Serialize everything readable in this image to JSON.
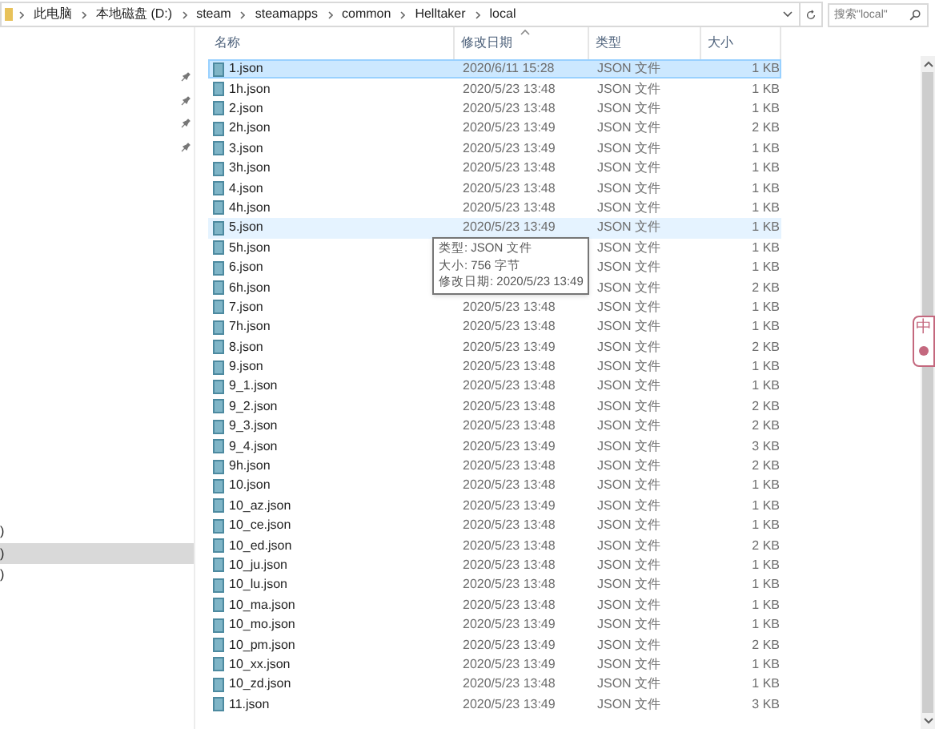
{
  "address_bar": {
    "path": [
      "此电脑",
      "本地磁盘 (D:)",
      "steam",
      "steamapps",
      "common",
      "Helltaker",
      "local"
    ]
  },
  "search": {
    "placeholder": "搜索\"local\""
  },
  "nav_pane": {
    "items": [
      {
        "label": ")",
        "selected": false
      },
      {
        "label": ")",
        "selected": true
      },
      {
        "label": ")",
        "selected": false
      }
    ]
  },
  "columns": [
    "名称",
    "修改日期",
    "类型",
    "大小"
  ],
  "rows": [
    {
      "name": "1.json",
      "modified": "2020/6/11 15:28",
      "type": "JSON 文件",
      "size": "1 KB",
      "selected": true,
      "hover": false
    },
    {
      "name": "1h.json",
      "modified": "2020/5/23 13:48",
      "type": "JSON 文件",
      "size": "1 KB",
      "selected": false,
      "hover": false
    },
    {
      "name": "2.json",
      "modified": "2020/5/23 13:48",
      "type": "JSON 文件",
      "size": "1 KB",
      "selected": false,
      "hover": false
    },
    {
      "name": "2h.json",
      "modified": "2020/5/23 13:49",
      "type": "JSON 文件",
      "size": "2 KB",
      "selected": false,
      "hover": false
    },
    {
      "name": "3.json",
      "modified": "2020/5/23 13:49",
      "type": "JSON 文件",
      "size": "1 KB",
      "selected": false,
      "hover": false
    },
    {
      "name": "3h.json",
      "modified": "2020/5/23 13:48",
      "type": "JSON 文件",
      "size": "1 KB",
      "selected": false,
      "hover": false
    },
    {
      "name": "4.json",
      "modified": "2020/5/23 13:48",
      "type": "JSON 文件",
      "size": "1 KB",
      "selected": false,
      "hover": false
    },
    {
      "name": "4h.json",
      "modified": "2020/5/23 13:48",
      "type": "JSON 文件",
      "size": "1 KB",
      "selected": false,
      "hover": false
    },
    {
      "name": "5.json",
      "modified": "2020/5/23 13:49",
      "type": "JSON 文件",
      "size": "1 KB",
      "selected": false,
      "hover": true
    },
    {
      "name": "5h.json",
      "type": "JSON 文件",
      "size": "1 KB",
      "selected": false,
      "hover": false
    },
    {
      "name": "6.json",
      "type": "JSON 文件",
      "size": "1 KB",
      "selected": false,
      "hover": false
    },
    {
      "name": "6h.json",
      "type": "JSON 文件",
      "size": "2 KB",
      "selected": false,
      "hover": false
    },
    {
      "name": "7.json",
      "modified": "2020/5/23 13:48",
      "type": "JSON 文件",
      "size": "1 KB",
      "selected": false,
      "hover": false
    },
    {
      "name": "7h.json",
      "modified": "2020/5/23 13:48",
      "type": "JSON 文件",
      "size": "1 KB",
      "selected": false,
      "hover": false
    },
    {
      "name": "8.json",
      "modified": "2020/5/23 13:49",
      "type": "JSON 文件",
      "size": "2 KB",
      "selected": false,
      "hover": false
    },
    {
      "name": "9.json",
      "modified": "2020/5/23 13:48",
      "type": "JSON 文件",
      "size": "1 KB",
      "selected": false,
      "hover": false
    },
    {
      "name": "9_1.json",
      "modified": "2020/5/23 13:48",
      "type": "JSON 文件",
      "size": "1 KB",
      "selected": false,
      "hover": false
    },
    {
      "name": "9_2.json",
      "modified": "2020/5/23 13:48",
      "type": "JSON 文件",
      "size": "2 KB",
      "selected": false,
      "hover": false
    },
    {
      "name": "9_3.json",
      "modified": "2020/5/23 13:48",
      "type": "JSON 文件",
      "size": "2 KB",
      "selected": false,
      "hover": false
    },
    {
      "name": "9_4.json",
      "modified": "2020/5/23 13:49",
      "type": "JSON 文件",
      "size": "3 KB",
      "selected": false,
      "hover": false
    },
    {
      "name": "9h.json",
      "modified": "2020/5/23 13:48",
      "type": "JSON 文件",
      "size": "2 KB",
      "selected": false,
      "hover": false
    },
    {
      "name": "10.json",
      "modified": "2020/5/23 13:48",
      "type": "JSON 文件",
      "size": "1 KB",
      "selected": false,
      "hover": false
    },
    {
      "name": "10_az.json",
      "modified": "2020/5/23 13:49",
      "type": "JSON 文件",
      "size": "1 KB",
      "selected": false,
      "hover": false
    },
    {
      "name": "10_ce.json",
      "modified": "2020/5/23 13:48",
      "type": "JSON 文件",
      "size": "1 KB",
      "selected": false,
      "hover": false
    },
    {
      "name": "10_ed.json",
      "modified": "2020/5/23 13:48",
      "type": "JSON 文件",
      "size": "2 KB",
      "selected": false,
      "hover": false
    },
    {
      "name": "10_ju.json",
      "modified": "2020/5/23 13:48",
      "type": "JSON 文件",
      "size": "1 KB",
      "selected": false,
      "hover": false
    },
    {
      "name": "10_lu.json",
      "modified": "2020/5/23 13:48",
      "type": "JSON 文件",
      "size": "1 KB",
      "selected": false,
      "hover": false
    },
    {
      "name": "10_ma.json",
      "modified": "2020/5/23 13:48",
      "type": "JSON 文件",
      "size": "1 KB",
      "selected": false,
      "hover": false
    },
    {
      "name": "10_mo.json",
      "modified": "2020/5/23 13:49",
      "type": "JSON 文件",
      "size": "1 KB",
      "selected": false,
      "hover": false
    },
    {
      "name": "10_pm.json",
      "modified": "2020/5/23 13:49",
      "type": "JSON 文件",
      "size": "2 KB",
      "selected": false,
      "hover": false
    },
    {
      "name": "10_xx.json",
      "modified": "2020/5/23 13:49",
      "type": "JSON 文件",
      "size": "1 KB",
      "selected": false,
      "hover": false
    },
    {
      "name": "10_zd.json",
      "modified": "2020/5/23 13:48",
      "type": "JSON 文件",
      "size": "1 KB",
      "selected": false,
      "hover": false
    },
    {
      "name": "11.json",
      "modified": "2020/5/23 13:49",
      "type": "JSON 文件",
      "size": "3 KB",
      "selected": false,
      "hover": false
    }
  ],
  "tooltip": {
    "lines": [
      "类型: JSON 文件",
      "大小: 756 字节",
      "修改日期: 2020/5/23 13:49"
    ]
  },
  "ime_badge": {
    "label": "中"
  }
}
